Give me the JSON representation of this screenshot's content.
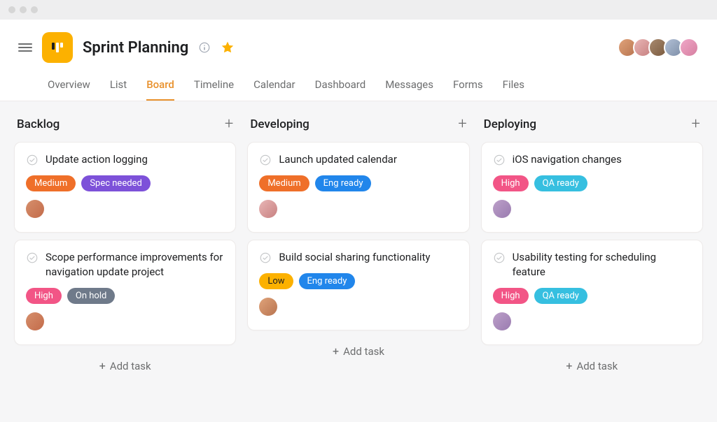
{
  "header": {
    "title": "Sprint Planning"
  },
  "tabs": {
    "t0": "Overview",
    "t1": "List",
    "t2": "Board",
    "t3": "Timeline",
    "t4": "Calendar",
    "t5": "Dashboard",
    "t6": "Messages",
    "t7": "Forms",
    "t8": "Files",
    "active": "Board"
  },
  "tag_colors": {
    "Medium": "#ef6f29",
    "Spec needed": "#7d51d9",
    "High": "#f25586",
    "On hold": "#6f7a8a",
    "Eng ready": "#2186eb",
    "Low": "#fcb100",
    "QA ready": "#36bfe0"
  },
  "columns": [
    {
      "title": "Backlog",
      "cards": [
        {
          "title": "Update action logging",
          "tags": [
            "Medium",
            "Spec needed"
          ],
          "avatar": "av1"
        },
        {
          "title": "Scope performance improvements for navigation update project",
          "tags": [
            "High",
            "On hold"
          ],
          "avatar": "av1"
        }
      ]
    },
    {
      "title": "Developing",
      "cards": [
        {
          "title": "Launch updated calendar",
          "tags": [
            "Medium",
            "Eng ready"
          ],
          "avatar": "av2"
        },
        {
          "title": "Build social sharing functionality",
          "tags": [
            "Low",
            "Eng ready"
          ],
          "avatar": "av3"
        }
      ]
    },
    {
      "title": "Deploying",
      "cards": [
        {
          "title": "iOS navigation changes",
          "tags": [
            "High",
            "QA ready"
          ],
          "avatar": "av4"
        },
        {
          "title": "Usability testing for scheduling feature",
          "tags": [
            "High",
            "QA ready"
          ],
          "avatar": "av4"
        }
      ]
    }
  ],
  "actions": {
    "add_task": "Add task"
  },
  "header_avatars": [
    "av3",
    "av2",
    "av5",
    "av6",
    "av7"
  ]
}
